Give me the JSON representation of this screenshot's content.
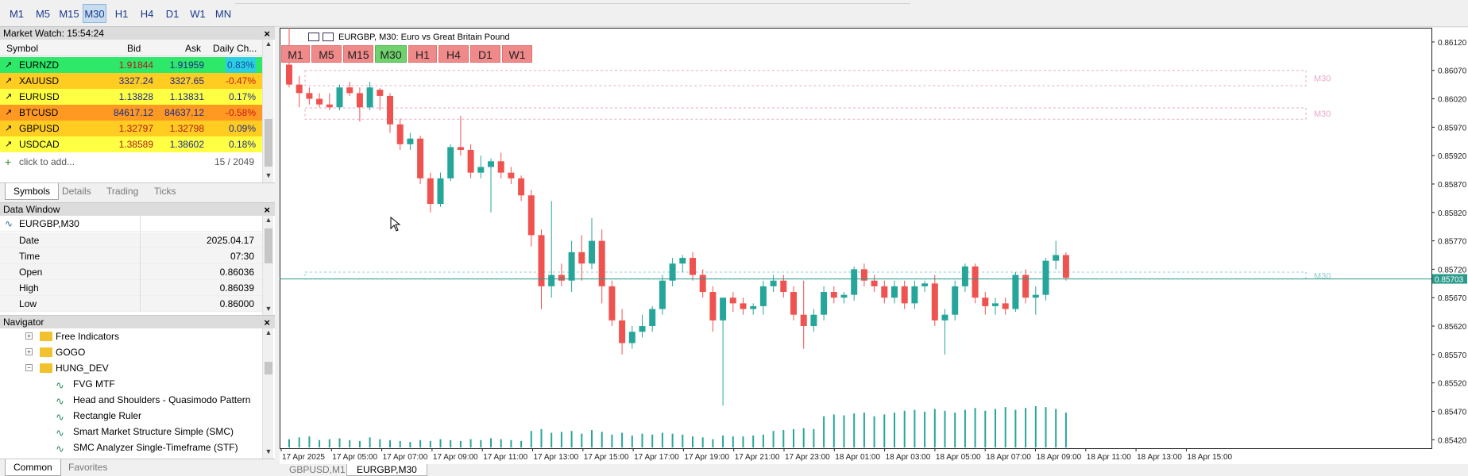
{
  "toolbar": {
    "timeframes": [
      {
        "label": "M1",
        "active": false
      },
      {
        "label": "M5",
        "active": false
      },
      {
        "label": "M15",
        "active": false
      },
      {
        "label": "M30",
        "active": true
      },
      {
        "label": "H1",
        "active": false
      },
      {
        "label": "H4",
        "active": false
      },
      {
        "label": "D1",
        "active": false
      },
      {
        "label": "W1",
        "active": false
      },
      {
        "label": "MN",
        "active": false
      }
    ]
  },
  "market_watch": {
    "title": "Market Watch: 15:54:24",
    "columns": [
      "Symbol",
      "Bid",
      "Ask",
      "Daily Ch..."
    ],
    "rows": [
      {
        "symbol": "EURNZD",
        "bid": "1.91844",
        "ask": "1.91959",
        "change": "0.83%",
        "bg": "#2ee86a",
        "bid_color": "#b01818",
        "ask_color": "#1a2a8a",
        "chg_color": "#1a4aa8"
      },
      {
        "symbol": "XAUUSD",
        "bid": "3327.24",
        "ask": "3327.65",
        "change": "-0.47%",
        "bg": "#ffcc22",
        "bid_color": "#1a2a8a",
        "ask_color": "#1a2a8a",
        "chg_color": "#c81818"
      },
      {
        "symbol": "EURUSD",
        "bid": "1.13828",
        "ask": "1.13831",
        "change": "0.17%",
        "bg": "#ffff44",
        "bid_color": "#1a2a8a",
        "ask_color": "#1a2a8a",
        "chg_color": "#1a2a8a"
      },
      {
        "symbol": "BTCUSD",
        "bid": "84617.12",
        "ask": "84637.12",
        "change": "-0.58%",
        "bg": "#ff9922",
        "bid_color": "#1a2a8a",
        "ask_color": "#1a2a8a",
        "chg_color": "#c81818"
      },
      {
        "symbol": "GBPUSD",
        "bid": "1.32797",
        "ask": "1.32798",
        "change": "0.09%",
        "bg": "#ffcc22",
        "bid_color": "#b01818",
        "ask_color": "#b01818",
        "chg_color": "#1a2a8a"
      },
      {
        "symbol": "USDCAD",
        "bid": "1.38589",
        "ask": "1.38602",
        "change": "0.18%",
        "bg": "#ffff44",
        "bid_color": "#b01818",
        "ask_color": "#1a2a8a",
        "chg_color": "#1a2a8a"
      }
    ],
    "add_label": "click to add...",
    "count": "15 / 2049",
    "tabs": [
      "Symbols",
      "Details",
      "Trading",
      "Ticks"
    ]
  },
  "data_window": {
    "title": "Data Window",
    "instrument": "EURGBP,M30",
    "rows": [
      {
        "key": "Date",
        "value": "2025.04.17"
      },
      {
        "key": "Time",
        "value": "07:30"
      },
      {
        "key": "Open",
        "value": "0.86036"
      },
      {
        "key": "High",
        "value": "0.86039"
      },
      {
        "key": "Low",
        "value": "0.86000"
      }
    ]
  },
  "navigator": {
    "title": "Navigator",
    "folders": [
      "Free Indicators",
      "GOGO",
      "HUNG_DEV"
    ],
    "indicators": [
      "FVG MTF",
      "Head and Shoulders - Quasimodo Pattern",
      "Rectangle Ruler",
      "Smart Market Structure Simple (SMC)",
      "SMC Analyzer Single-Timeframe (STF)"
    ],
    "tabs": [
      "Common",
      "Favorites"
    ]
  },
  "chart": {
    "title": "EURGBP, M30:  Euro vs Great Britain Pound",
    "tf_buttons": [
      {
        "label": "M1",
        "active": false
      },
      {
        "label": "M5",
        "active": false
      },
      {
        "label": "M15",
        "active": false
      },
      {
        "label": "M30",
        "active": true
      },
      {
        "label": "H1",
        "active": false
      },
      {
        "label": "H4",
        "active": false
      },
      {
        "label": "D1",
        "active": false
      },
      {
        "label": "W1",
        "active": false
      }
    ],
    "bottom_tabs": [
      {
        "label": "GBPUSD,M1",
        "active": false
      },
      {
        "label": "EURGBP,M30",
        "active": true
      }
    ]
  },
  "chart_data": {
    "type": "candlestick",
    "symbol": "EURGBP",
    "timeframe": "M30",
    "ylim": [
      0.85405,
      0.86145
    ],
    "y_ticks": [
      "0.86120",
      "0.86070",
      "0.86020",
      "0.85970",
      "0.85920",
      "0.85870",
      "0.85820",
      "0.85770",
      "0.85720",
      "0.85670",
      "0.85620",
      "0.85570",
      "0.85520",
      "0.85470",
      "0.85420"
    ],
    "x_labels": [
      "17 Apr 2025",
      "17 Apr 05:00",
      "17 Apr 07:00",
      "17 Apr 09:00",
      "17 Apr 11:00",
      "17 Apr 13:00",
      "17 Apr 15:00",
      "17 Apr 17:00",
      "17 Apr 19:00",
      "17 Apr 21:00",
      "17 Apr 23:00",
      "18 Apr 01:00",
      "18 Apr 03:00",
      "18 Apr 05:00",
      "18 Apr 07:00",
      "18 Apr 09:00",
      "18 Apr 11:00",
      "18 Apr 13:00",
      "18 Apr 15:00"
    ],
    "current_price": "0.85703",
    "current_price_value": 0.85703,
    "zones": [
      {
        "label": "M30",
        "top": 0.8607,
        "bottom": 0.86043,
        "color": "#e8a8c8"
      },
      {
        "label": "M30",
        "top": 0.86004,
        "bottom": 0.85984,
        "color": "#e8a8c8"
      },
      {
        "label": "M30",
        "top": 0.85715,
        "bottom": 0.85703,
        "color": "#8fd0d0"
      }
    ],
    "up_color": "#26a69a",
    "down_color": "#ef5350",
    "candles": [
      [
        0.8608,
        0.8615,
        0.8604,
        0.86045
      ],
      [
        0.86045,
        0.8606,
        0.86005,
        0.8603
      ],
      [
        0.8603,
        0.8604,
        0.8601,
        0.8602
      ],
      [
        0.8602,
        0.8603,
        0.86005,
        0.8601
      ],
      [
        0.8601,
        0.8603,
        0.86,
        0.86005
      ],
      [
        0.86005,
        0.86045,
        0.86,
        0.8604
      ],
      [
        0.8604,
        0.8605,
        0.86025,
        0.8603
      ],
      [
        0.8603,
        0.8604,
        0.8598,
        0.86005
      ],
      [
        0.86005,
        0.8605,
        0.86,
        0.8604
      ],
      [
        0.86036,
        0.86039,
        0.86,
        0.86025
      ],
      [
        0.86025,
        0.8603,
        0.8596,
        0.85975
      ],
      [
        0.85975,
        0.85985,
        0.8593,
        0.8594
      ],
      [
        0.8594,
        0.8596,
        0.8593,
        0.8595
      ],
      [
        0.8595,
        0.85955,
        0.8587,
        0.8588
      ],
      [
        0.8588,
        0.8589,
        0.8582,
        0.85835
      ],
      [
        0.85835,
        0.8589,
        0.8583,
        0.8588
      ],
      [
        0.8588,
        0.8594,
        0.85875,
        0.85935
      ],
      [
        0.85935,
        0.8599,
        0.8592,
        0.8593
      ],
      [
        0.8593,
        0.8594,
        0.8588,
        0.8589
      ],
      [
        0.8589,
        0.8592,
        0.8588,
        0.859
      ],
      [
        0.859,
        0.85915,
        0.8582,
        0.8591
      ],
      [
        0.8591,
        0.85925,
        0.8588,
        0.8589
      ],
      [
        0.8589,
        0.859,
        0.8587,
        0.8588
      ],
      [
        0.8588,
        0.85885,
        0.8584,
        0.8585
      ],
      [
        0.8585,
        0.8586,
        0.8576,
        0.8578
      ],
      [
        0.8578,
        0.8579,
        0.8565,
        0.8569
      ],
      [
        0.8569,
        0.8584,
        0.8567,
        0.8571
      ],
      [
        0.8571,
        0.8573,
        0.8569,
        0.857
      ],
      [
        0.857,
        0.8577,
        0.8568,
        0.8575
      ],
      [
        0.8575,
        0.8578,
        0.857,
        0.8573
      ],
      [
        0.8573,
        0.8581,
        0.8572,
        0.8577
      ],
      [
        0.8577,
        0.8579,
        0.8566,
        0.8569
      ],
      [
        0.8569,
        0.857,
        0.8562,
        0.8563
      ],
      [
        0.8563,
        0.8565,
        0.8557,
        0.8559
      ],
      [
        0.8559,
        0.8562,
        0.8558,
        0.8561
      ],
      [
        0.8561,
        0.8564,
        0.856,
        0.8562
      ],
      [
        0.8562,
        0.85655,
        0.8561,
        0.8565
      ],
      [
        0.8565,
        0.8571,
        0.8564,
        0.857
      ],
      [
        0.857,
        0.8574,
        0.8569,
        0.8573
      ],
      [
        0.8573,
        0.85745,
        0.85715,
        0.8574
      ],
      [
        0.8574,
        0.8575,
        0.857,
        0.8571
      ],
      [
        0.8571,
        0.8572,
        0.8567,
        0.8568
      ],
      [
        0.8568,
        0.8569,
        0.8561,
        0.8563
      ],
      [
        0.8563,
        0.8566,
        0.8548,
        0.8567
      ],
      [
        0.8567,
        0.8568,
        0.85645,
        0.8566
      ],
      [
        0.8566,
        0.8567,
        0.8564,
        0.8565
      ],
      [
        0.8565,
        0.8566,
        0.8564,
        0.85655
      ],
      [
        0.85655,
        0.857,
        0.8564,
        0.8569
      ],
      [
        0.8569,
        0.8571,
        0.8568,
        0.857
      ],
      [
        0.857,
        0.8571,
        0.8567,
        0.8568
      ],
      [
        0.8568,
        0.8569,
        0.8563,
        0.8564
      ],
      [
        0.8564,
        0.857,
        0.8558,
        0.8562
      ],
      [
        0.8562,
        0.8565,
        0.8561,
        0.8564
      ],
      [
        0.8564,
        0.8569,
        0.8563,
        0.8568
      ],
      [
        0.8568,
        0.8569,
        0.8566,
        0.8567
      ],
      [
        0.8567,
        0.8568,
        0.8566,
        0.85675
      ],
      [
        0.85675,
        0.85725,
        0.85665,
        0.8572
      ],
      [
        0.8572,
        0.8573,
        0.8569,
        0.857
      ],
      [
        0.857,
        0.8571,
        0.8568,
        0.8569
      ],
      [
        0.8569,
        0.857,
        0.8566,
        0.8567
      ],
      [
        0.8567,
        0.857,
        0.8566,
        0.8569
      ],
      [
        0.8569,
        0.857,
        0.8565,
        0.8566
      ],
      [
        0.8566,
        0.857,
        0.8565,
        0.8569
      ],
      [
        0.8569,
        0.857,
        0.8568,
        0.85695
      ],
      [
        0.85695,
        0.8571,
        0.8562,
        0.8563
      ],
      [
        0.8563,
        0.8565,
        0.8557,
        0.8564
      ],
      [
        0.8564,
        0.857,
        0.8563,
        0.8569
      ],
      [
        0.8569,
        0.8573,
        0.8568,
        0.85725
      ],
      [
        0.85725,
        0.8573,
        0.8566,
        0.8567
      ],
      [
        0.8567,
        0.8568,
        0.8564,
        0.85655
      ],
      [
        0.85655,
        0.8567,
        0.8564,
        0.8566
      ],
      [
        0.8566,
        0.8567,
        0.8564,
        0.8565
      ],
      [
        0.8565,
        0.85715,
        0.85645,
        0.8571
      ],
      [
        0.8571,
        0.8572,
        0.8566,
        0.8567
      ],
      [
        0.8567,
        0.8569,
        0.8564,
        0.85675
      ],
      [
        0.85675,
        0.8574,
        0.85665,
        0.85735
      ],
      [
        0.85735,
        0.8577,
        0.8572,
        0.85745
      ],
      [
        0.85745,
        0.8575,
        0.857,
        0.85705
      ]
    ],
    "volumes": [
      9,
      11,
      12,
      8,
      9,
      10,
      8,
      7,
      11,
      9,
      8,
      7,
      6,
      8,
      7,
      9,
      8,
      7,
      9,
      8,
      10,
      9,
      8,
      7,
      18,
      20,
      16,
      17,
      18,
      15,
      19,
      17,
      14,
      16,
      13,
      15,
      14,
      16,
      15,
      14,
      12,
      11,
      9,
      13,
      12,
      12,
      13,
      14,
      18,
      19,
      20,
      21,
      20,
      34,
      36,
      35,
      37,
      38,
      34,
      36,
      38,
      40,
      41,
      39,
      42,
      40,
      38,
      41,
      43,
      40,
      42,
      44,
      41,
      43,
      45,
      44,
      42,
      38
    ]
  }
}
